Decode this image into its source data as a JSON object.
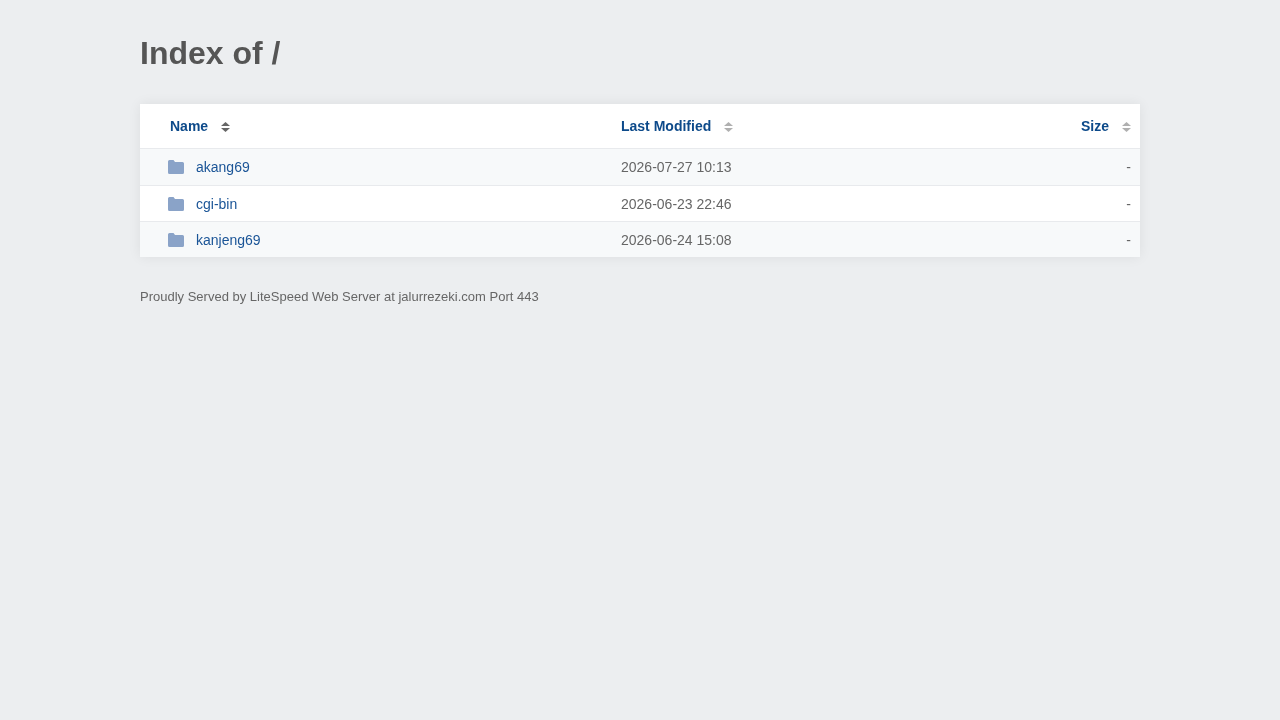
{
  "title": "Index of /",
  "table": {
    "columns": [
      {
        "label": "Name",
        "sorted": true
      },
      {
        "label": "Last Modified",
        "sorted": false
      },
      {
        "label": "Size",
        "sorted": false
      }
    ],
    "rows": [
      {
        "kind": "folder",
        "name": "akang69",
        "modified": "2026-07-27 10:13",
        "size": "-"
      },
      {
        "kind": "folder",
        "name": "cgi-bin",
        "modified": "2026-06-23 22:46",
        "size": "-"
      },
      {
        "kind": "folder",
        "name": "kanjeng69",
        "modified": "2026-06-24 15:08",
        "size": "-"
      }
    ]
  },
  "footer": "Proudly Served by LiteSpeed Web Server at jalurrezeki.com Port 443"
}
